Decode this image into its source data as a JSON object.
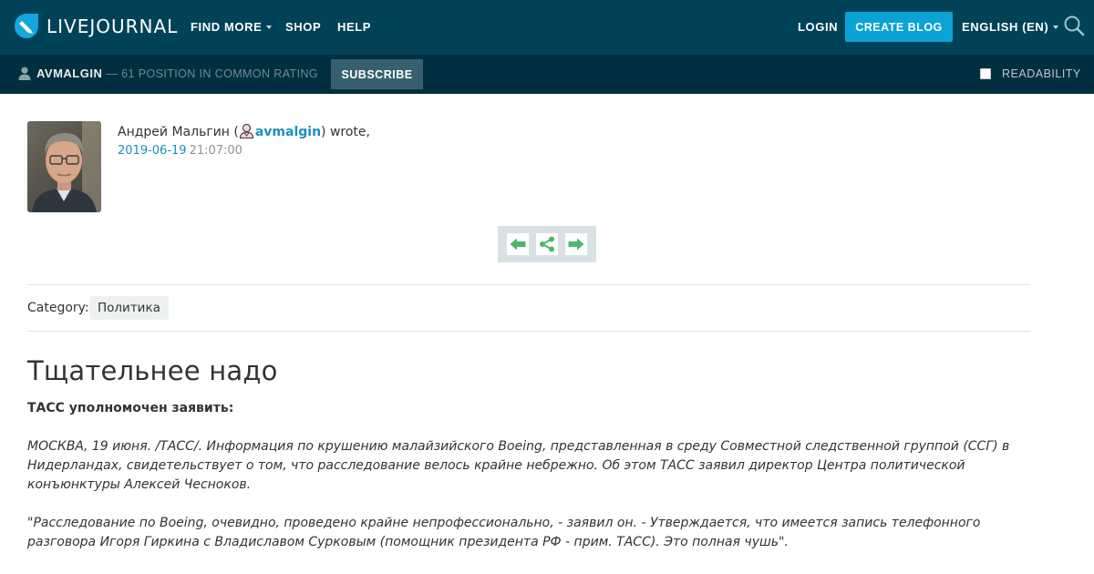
{
  "header": {
    "logo_text": "LIVEJOURNAL",
    "nav": [
      {
        "label": "FIND MORE",
        "has_dropdown": true
      },
      {
        "label": "SHOP",
        "has_dropdown": false
      },
      {
        "label": "HELP",
        "has_dropdown": false
      }
    ],
    "login_label": "LOGIN",
    "create_blog_label": "CREATE BLOG",
    "language_label": "ENGLISH (EN)",
    "icons": {
      "search": "search-icon",
      "logo": "livejournal-logo-icon"
    },
    "colors": {
      "top_bar": "#004359",
      "sub_bar": "#002f3f",
      "accent": "#0aa3d4"
    }
  },
  "subbar": {
    "username": "AVMALGIN",
    "rating_text": "— 61 POSITION IN COMMON RATING",
    "subscribe_label": "SUBSCRIBE",
    "readability_label": "READABILITY",
    "readability_checked": false
  },
  "entry": {
    "author_name": "Андрей Мальгин (",
    "author_username": "avmalgin",
    "wrote_text": ") wrote,",
    "date": "2019-06-19",
    "time": "21:07:00",
    "nav_buttons": [
      "prev-arrow-icon",
      "share-icon",
      "next-arrow-icon"
    ],
    "category_label": "Category:",
    "category_tag": "Политика",
    "title": "Тщательнее надо",
    "body": {
      "lead": "ТАСС уполномочен заявить:",
      "paragraph_1": "МОСКВА, 19 июня. /ТАСС/. Информация по крушению малайзийского Boeing, представленная в среду Совместной следственной группой (ССГ) в Нидерландах, свидетельствует о том, что расследование велось крайне небрежно. Об этом ТАСС заявил директор Центра политической конъюнктуры Алексей Чесноков.",
      "paragraph_2": "\"Расследование по Boeing, очевидно, проведено крайне непрофессионально, - заявил он. - Утверждается, что имеется запись телефонного разговора Игоря Гиркина с Владиславом Сурковым (помощник президента РФ - прим. ТАСС). Это полная чушь\"."
    }
  }
}
